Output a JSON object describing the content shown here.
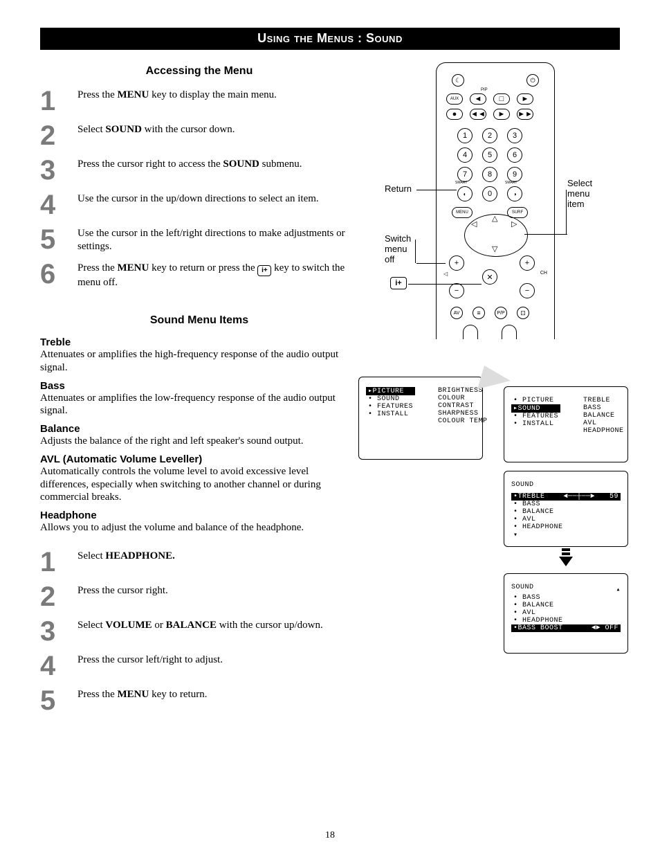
{
  "page_title": "Using the Menus : Sound",
  "section_accessing": "Accessing the Menu",
  "steps_a": [
    {
      "n": "1",
      "pre": "Press the ",
      "b1": "MENU",
      "post": " key to display the main menu."
    },
    {
      "n": "2",
      "pre": "Select ",
      "b1": "SOUND",
      "post": " with the cursor down."
    },
    {
      "n": "3",
      "pre": "Press the cursor right to access the ",
      "b1": "SOUND",
      "post": " submenu."
    },
    {
      "n": "4",
      "pre": "Use the cursor in the up/down directions to select an item.",
      "b1": "",
      "post": ""
    },
    {
      "n": "5",
      "pre": "Use the cursor in the left/right directions to make adjustments or settings.",
      "b1": "",
      "post": ""
    }
  ],
  "step_a6": {
    "n": "6",
    "pre": "Press the ",
    "b1": "MENU",
    "mid": " key to return or press the ",
    "icon": "i+",
    "post": " key to switch the menu off."
  },
  "section_items": "Sound Menu Items",
  "items": {
    "treble_h": "Treble",
    "treble_p": "Attenuates or amplifies the high-frequency response of the audio output signal.",
    "bass_h": "Bass",
    "bass_p": "Attenuates or amplifies the low-frequency response of the audio output signal.",
    "balance_h": "Balance",
    "balance_p": "Adjusts the balance of the right and left speaker's sound output.",
    "avl_h": "AVL (Automatic Volume Leveller)",
    "avl_p": "Automatically controls the volume level to avoid excessive level differences, especially when switching to another channel or during commercial breaks.",
    "head_h": "Headphone",
    "head_p": "Allows you to adjust the volume and balance of the headphone."
  },
  "steps_b": [
    {
      "n": "1",
      "pre": "Select ",
      "b1": "HEADPHONE.",
      "post": ""
    },
    {
      "n": "2",
      "pre": "Press the cursor right.",
      "b1": "",
      "post": ""
    },
    {
      "n": "3",
      "pre": "Select ",
      "b1": "VOLUME",
      "mid": " or ",
      "b2": "BALANCE",
      "post": " with the cursor up/down."
    },
    {
      "n": "4",
      "pre": "Press the cursor left/right to adjust.",
      "b1": "",
      "post": ""
    },
    {
      "n": "5",
      "pre": "Press the ",
      "b1": "MENU",
      "post": " key to return."
    }
  ],
  "remote_labels": {
    "return": "Return",
    "select": "Select menu item",
    "switch": "Switch menu off",
    "info": "i+"
  },
  "osd1_left": [
    "PICTURE",
    "SOUND",
    "FEATURES",
    "INSTALL"
  ],
  "osd1_right": [
    "BRIGHTNESS",
    "COLOUR",
    "CONTRAST",
    "SHARPNESS",
    "COLOUR TEMP"
  ],
  "osd2_left": [
    "PICTURE",
    "SOUND",
    "FEATURES",
    "INSTALL"
  ],
  "osd2_right": [
    "TREBLE",
    "BASS",
    "BALANCE",
    "AVL",
    "HEADPHONE"
  ],
  "osd3_title": "SOUND",
  "osd3_items": [
    "TREBLE",
    "BASS",
    "BALANCE",
    "AVL",
    "HEADPHONE"
  ],
  "osd3_val": "59",
  "osd4_title": "SOUND",
  "osd4_items": [
    "BASS",
    "BALANCE",
    "AVL",
    "HEADPHONE",
    "BASS BOOST"
  ],
  "osd4_val": "OFF",
  "page_number": "18"
}
